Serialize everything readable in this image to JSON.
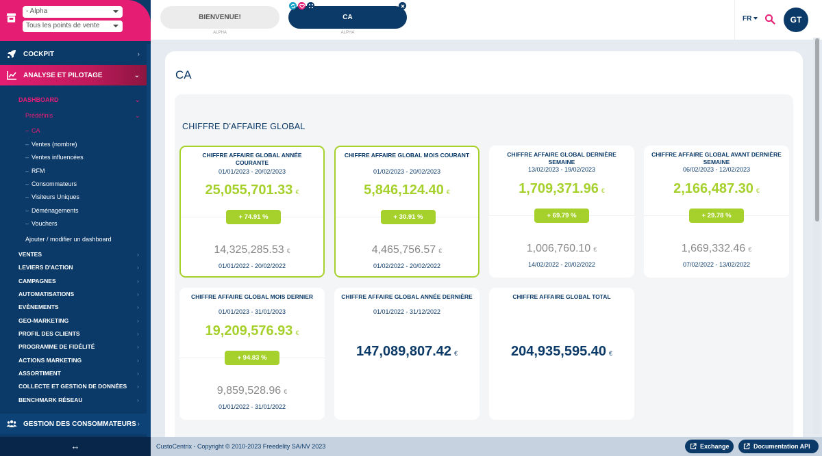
{
  "sidebar": {
    "brand_selector": {
      "value": "- Alpha"
    },
    "store_selector": {
      "value": "Tous les points de vente"
    },
    "main_items": [
      {
        "label": "COCKPIT",
        "icon": "rocket-icon"
      },
      {
        "label": "ANALYSE ET PILOTAGE",
        "icon": "chart-line-icon"
      }
    ],
    "dashboard": {
      "label": "DASHBOARD",
      "predefined_label": "Prédéfinis",
      "items": [
        "CA",
        "Ventes (nombre)",
        "Ventes influencées",
        "RFM",
        "Consommateurs",
        "Visiteurs Uniques",
        "Déménagements",
        "Vouchers"
      ],
      "active_item": "CA",
      "add_label": "Ajouter / modifier un dashboard"
    },
    "sections": [
      "VENTES",
      "LEVIERS D'ACTION",
      "CAMPAGNES",
      "AUTOMATISATIONS",
      "EVÈNEMENTS",
      "GEO-MARKETING",
      "PROFIL DES CLIENTS",
      "PROGRAMME DE FIDÉLITÉ",
      "ACTIONS MARKETING",
      "ASSORTIMENT",
      "COLLECTE ET GESTION DE DONNÉES",
      "BENCHMARK RÉSEAU"
    ],
    "gestion": {
      "label": "GESTION DES CONSOMMATEURS",
      "icon": "users-icon"
    },
    "collapse_icon": "↔"
  },
  "topbar": {
    "tabs": [
      {
        "label": "BIENVENUE!",
        "sub": "ALPHA",
        "active": false
      },
      {
        "label": "CA",
        "sub": "ALPHA",
        "active": true
      }
    ],
    "language": "FR",
    "avatar_initials": "GT"
  },
  "main": {
    "page_title": "CA",
    "section_title": "CHIFFRE D'AFFAIRE GLOBAL",
    "currency": "€",
    "kpis": [
      {
        "title": "CHIFFRE AFFAIRE GLOBAL ANNÉE COURANTE",
        "period": "01/01/2023 - 20/02/2023",
        "value": "25,055,701.33",
        "change": "+ 74.91 %",
        "previous_value": "14,325,285.53",
        "previous_period": "01/01/2022 - 20/02/2022",
        "highlighted": true
      },
      {
        "title": "CHIFFRE AFFAIRE GLOBAL MOIS COURANT",
        "period": "01/02/2023 - 20/02/2023",
        "value": "5,846,124.40",
        "change": "+ 30.91 %",
        "previous_value": "4,465,756.57",
        "previous_period": "01/02/2022 - 20/02/2022",
        "highlighted": true
      },
      {
        "title": "CHIFFRE AFFAIRE GLOBAL DERNIÈRE SEMAINE",
        "period": "13/02/2023 - 19/02/2023",
        "value": "1,709,371.96",
        "change": "+ 69.79 %",
        "previous_value": "1,006,760.10",
        "previous_period": "14/02/2022 - 20/02/2022",
        "highlighted": false
      },
      {
        "title": "CHIFFRE AFFAIRE GLOBAL AVANT DERNIÈRE SEMAINE",
        "period": "06/02/2023 - 12/02/2023",
        "value": "2,166,487.30",
        "change": "+ 29.78 %",
        "previous_value": "1,669,332.46",
        "previous_period": "07/02/2022 - 13/02/2022",
        "highlighted": false
      },
      {
        "title": "CHIFFRE AFFAIRE GLOBAL MOIS DERNIER",
        "period": "01/01/2023 - 31/01/2023",
        "value": "19,209,576.93",
        "change": "+ 94.83 %",
        "previous_value": "9,859,528.96",
        "previous_period": "01/01/2022 - 31/01/2022",
        "highlighted": false
      },
      {
        "title": "CHIFFRE AFFAIRE GLOBAL ANNÉE DERNIÈRE",
        "period": "01/01/2022 - 31/12/2022",
        "value": "147,089,807.42"
      },
      {
        "title": "CHIFFRE AFFAIRE GLOBAL TOTAL",
        "value": "204,935,595.40"
      }
    ]
  },
  "footer": {
    "copyright": "CustoCentrix - Copyright © 2010-2023 Freedelity SA/NV 2023",
    "buttons": [
      "Exchange",
      "Documentation API"
    ]
  },
  "colors": {
    "brand_pink": "#e51d73",
    "navy": "#0b3a68",
    "accent_green": "#a6d12c"
  }
}
